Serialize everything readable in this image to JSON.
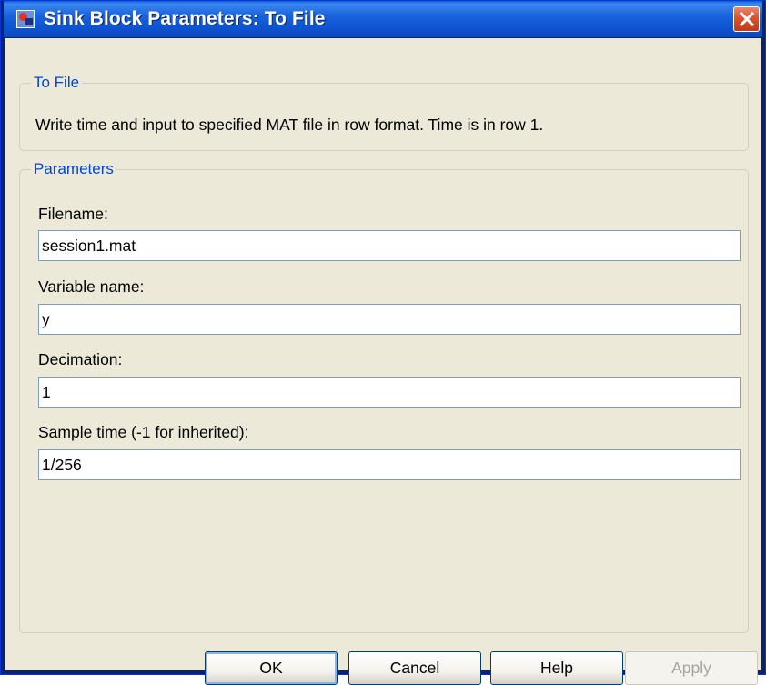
{
  "window": {
    "title": "Sink Block Parameters: To File",
    "close_icon": "close-icon"
  },
  "block_group": {
    "legend": "To File",
    "description": "Write time and input to specified MAT file in row format.  Time is in row 1."
  },
  "params_group": {
    "legend": "Parameters",
    "fields": [
      {
        "label": "Filename:",
        "value": "session1.mat"
      },
      {
        "label": "Variable name:",
        "value": "y"
      },
      {
        "label": "Decimation:",
        "value": "1"
      },
      {
        "label": "Sample time (-1 for inherited):",
        "value": "1/256"
      }
    ]
  },
  "buttons": {
    "ok": "OK",
    "cancel": "Cancel",
    "help": "Help",
    "apply": "Apply"
  },
  "colors": {
    "titlebar": "#0a5fd8",
    "legend_text": "#0046d5",
    "dialog_bg": "#ece9d8",
    "close_button": "#d8532e"
  }
}
